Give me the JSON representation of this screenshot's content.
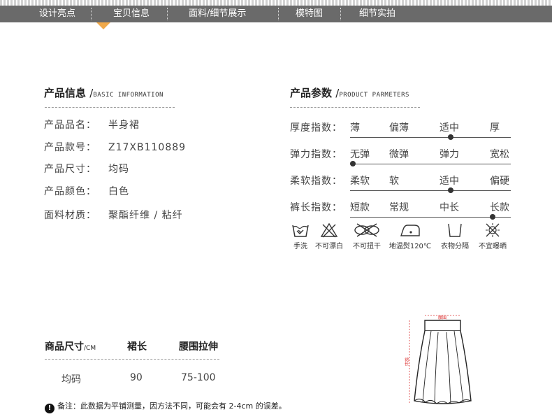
{
  "nav": {
    "items": [
      "设计亮点",
      "宝贝信息",
      "面料/细节展示",
      "模特图",
      "细节实拍"
    ],
    "active_index": 1,
    "bar_color": "#6a6a6a",
    "marker_color": "#f0a94a"
  },
  "product_info": {
    "title": "产品信息",
    "slash": "/",
    "title_en": "BASIC INFORMATION",
    "rows": [
      {
        "label": "产品品名：",
        "value": "半身裙"
      },
      {
        "label": "产品款号：",
        "value": "Z17XB110889"
      },
      {
        "label": "产品尺寸：",
        "value": "均码"
      },
      {
        "label": "产品颜色：",
        "value": "白色"
      },
      {
        "label": "面料材质：",
        "value": "聚酯纤维 / 粘纤"
      }
    ]
  },
  "product_params": {
    "title": "产品参数",
    "slash": "/",
    "title_en": "PRODUCT PARMETERS",
    "rows": [
      {
        "label": "厚度指数：",
        "options": [
          "薄",
          "偏薄",
          "适中",
          "厚"
        ],
        "selected": 2
      },
      {
        "label": "弹力指数：",
        "options": [
          "无弹",
          "微弹",
          "弹力",
          "宽松"
        ],
        "selected": 0
      },
      {
        "label": "柔软指数：",
        "options": [
          "柔软",
          "软",
          "适中",
          "偏硬"
        ],
        "selected": 2
      },
      {
        "label": "裤长指数：",
        "options": [
          "短款",
          "常规",
          "中长",
          "长款"
        ],
        "selected": 3
      }
    ]
  },
  "care": [
    {
      "icon": "hand-wash-icon",
      "label": "手洗"
    },
    {
      "icon": "no-bleach-icon",
      "label": "不可漂白"
    },
    {
      "icon": "no-wring-icon",
      "label": "不可扭干"
    },
    {
      "icon": "low-iron-icon",
      "label": "地温熨120℃"
    },
    {
      "icon": "separate-wash-icon",
      "label": "衣物分隔"
    },
    {
      "icon": "no-sun-dry-icon",
      "label": "不宜曝晒"
    }
  ],
  "size_table": {
    "headers": [
      "商品尺寸",
      "裙长",
      "腰围拉伸"
    ],
    "unit": "/CM",
    "rows": [
      [
        "均码",
        "90",
        "75-100"
      ]
    ]
  },
  "skirt_diagram": {
    "waist_label": "腰围",
    "length_label": "裙长"
  },
  "note": {
    "icon": "exclamation-icon",
    "text": "备注：此数据为平铺测量，因方法不同，可能会有 2-4cm 的误差。"
  }
}
